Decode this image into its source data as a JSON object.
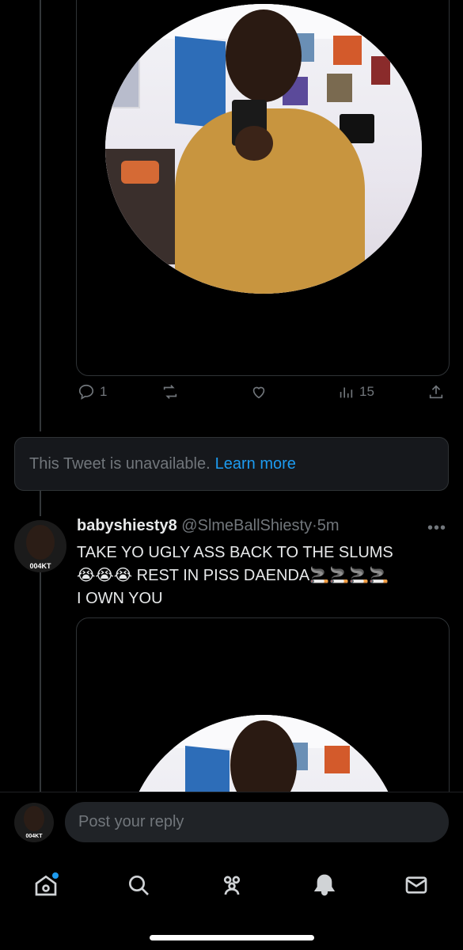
{
  "first_tweet": {
    "actions": {
      "reply_count": "1",
      "retweet_count": "",
      "like_count": "",
      "views_count": "15"
    }
  },
  "unavailable": {
    "text": "This Tweet is unavailable.",
    "link": "Learn more"
  },
  "tweet": {
    "display_name": "babyshiesty8",
    "handle": "@SlmeBallShiesty",
    "separator": "·",
    "time": "5m",
    "avatar_tag": "004KT",
    "line1": "TAKE YO UGLY ASS BACK TO THE SLUMS",
    "line2": "😭😭😭 REST IN PISS DAENDA🚬🚬🚬🚬",
    "line3": "I OWN YOU"
  },
  "reply": {
    "placeholder": "Post your reply",
    "avatar_tag": "004KT"
  },
  "tabbar": {
    "items": [
      "home-icon",
      "search-icon",
      "communities-icon",
      "notifications-icon",
      "messages-icon"
    ],
    "has_home_notification": true
  },
  "colors": {
    "background": "#000000",
    "link": "#1d9bf0",
    "muted": "#71767b",
    "text": "#e7e9ea"
  }
}
